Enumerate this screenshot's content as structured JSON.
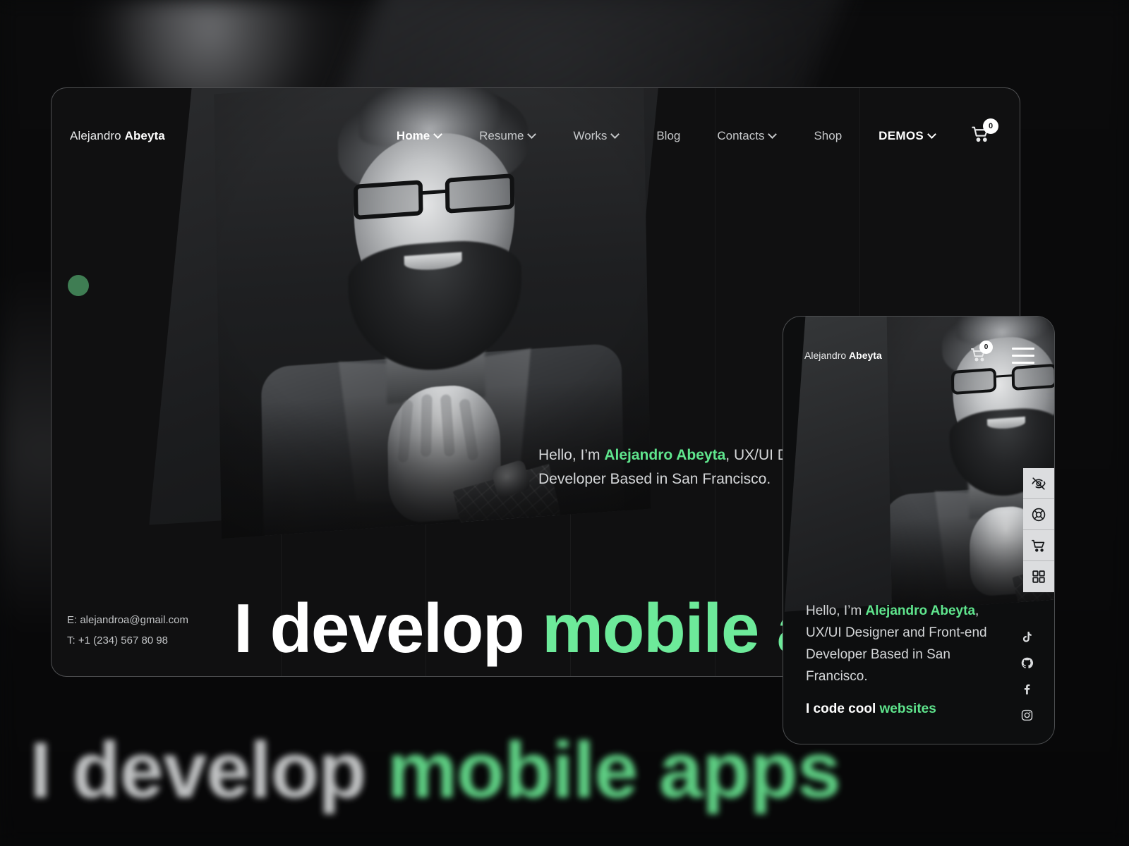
{
  "brand": {
    "first_name": "Alejandro",
    "last_name": "Abeyta",
    "accent_green": "#5fe58d",
    "headline_green": "#6dea9a"
  },
  "desktop": {
    "nav": [
      {
        "label": "Home",
        "has_chevron": true,
        "active": true
      },
      {
        "label": "Resume",
        "has_chevron": true,
        "active": false
      },
      {
        "label": "Works",
        "has_chevron": true,
        "active": false
      },
      {
        "label": "Blog",
        "has_chevron": false,
        "active": false
      },
      {
        "label": "Contacts",
        "has_chevron": true,
        "active": false
      },
      {
        "label": "Shop",
        "has_chevron": false,
        "active": false
      },
      {
        "label": "DEMOS",
        "has_chevron": true,
        "active": false
      }
    ],
    "cart": {
      "icon": "cart-icon",
      "count": "0"
    },
    "hero": {
      "greeting": "Hello, I’m ",
      "name": "Alejandro Abeyta",
      "rest": ", UX/UI Designer and Front-end Developer Based in San Francisco."
    },
    "headline": {
      "plain": "I develop ",
      "accent": "mobile apps"
    },
    "contact": {
      "email": "E: alejandroa@gmail.com",
      "phone": "T: +1 (234) 567 80 98"
    }
  },
  "mobile": {
    "cart": {
      "icon": "cart-icon",
      "count": "0"
    },
    "menu_icon": "hamburger-menu-icon",
    "hero": {
      "greeting": "Hello, I’m ",
      "name": "Alejandro Abeyta",
      "rest": ", UX/UI Designer and Front-end Developer Based in San Francisco."
    },
    "tagline": {
      "plain": "I code cool ",
      "accent": "websites"
    }
  },
  "rail": [
    {
      "icon": "eye-off-icon",
      "name": "toggle-visibility"
    },
    {
      "icon": "lifebuoy-icon",
      "name": "support"
    },
    {
      "icon": "cart-icon",
      "name": "cart"
    },
    {
      "icon": "grid-icon",
      "name": "layouts"
    }
  ],
  "social": [
    {
      "icon": "tiktok-icon",
      "label": "TikTok"
    },
    {
      "icon": "github-icon",
      "label": "GitHub"
    },
    {
      "icon": "facebook-icon",
      "label": "Facebook"
    },
    {
      "icon": "instagram-icon",
      "label": "Instagram"
    }
  ],
  "backdrop": {
    "plain": "I develop ",
    "accent": "mobile apps"
  }
}
